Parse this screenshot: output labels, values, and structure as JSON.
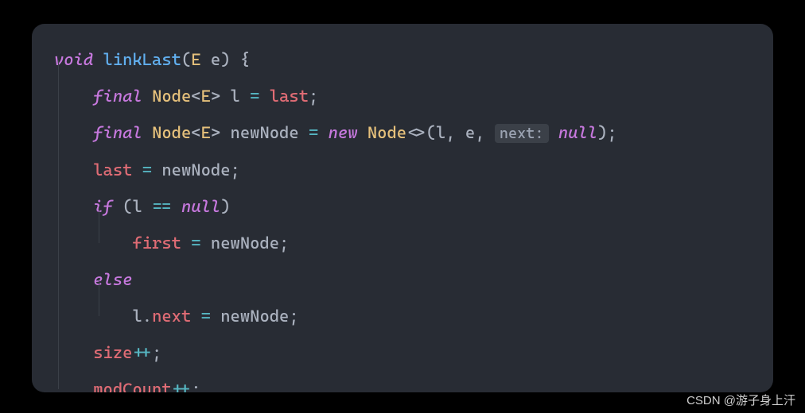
{
  "code": {
    "line1": {
      "void": "void",
      "space1": " ",
      "fn": "linkLast",
      "paren_open": "(",
      "ptype": "E",
      "space2": " ",
      "pname": "e",
      "paren_close": ")",
      "space3": " ",
      "brace": "{"
    },
    "line2": {
      "indent": "    ",
      "final": "final",
      "space1": " ",
      "type": "Node",
      "lt": "<",
      "gparam": "E",
      "gt": ">",
      "space2": " ",
      "var": "l",
      "space3": " ",
      "eq": "=",
      "space4": " ",
      "rhs": "last",
      "semi": ";"
    },
    "line3": {
      "indent": "    ",
      "final": "final",
      "space1": " ",
      "type": "Node",
      "lt": "<",
      "gparam": "E",
      "gt": ">",
      "space2": " ",
      "var": "newNode",
      "space3": " ",
      "eq": "=",
      "space4": " ",
      "new": "new",
      "space5": " ",
      "ctor": "Node",
      "diamond": "<>",
      "paren_open": "(",
      "arg1": "l",
      "comma1": ",",
      "space6": " ",
      "arg2": "e",
      "comma2": ",",
      "space7": " ",
      "hint": "next:",
      "space8": " ",
      "nullkw": "null",
      "paren_close": ")",
      "semi": ";"
    },
    "line4": {
      "indent": "    ",
      "lhs": "last",
      "space1": " ",
      "eq": "=",
      "space2": " ",
      "rhs": "newNode",
      "semi": ";"
    },
    "line5": {
      "indent": "    ",
      "if": "if",
      "space1": " ",
      "paren_open": "(",
      "var": "l",
      "space2": " ",
      "eqeq": "==",
      "space3": " ",
      "nullkw": "null",
      "paren_close": ")"
    },
    "line6": {
      "indent": "        ",
      "lhs": "first",
      "space1": " ",
      "eq": "=",
      "space2": " ",
      "rhs": "newNode",
      "semi": ";"
    },
    "line7": {
      "indent": "    ",
      "else": "else"
    },
    "line8": {
      "indent": "        ",
      "obj": "l",
      "dot": ".",
      "field": "next",
      "space1": " ",
      "eq": "=",
      "space2": " ",
      "rhs": "newNode",
      "semi": ";"
    },
    "line9": {
      "indent": "    ",
      "var": "size",
      "inc": "++",
      "semi": ";"
    },
    "line10": {
      "indent": "    ",
      "var": "modCount",
      "inc": "++",
      "semi": ";"
    }
  },
  "watermark": "CSDN @游子身上汗"
}
